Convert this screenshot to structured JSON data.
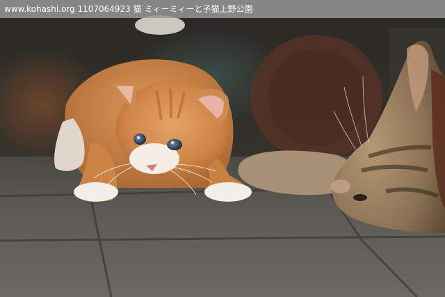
{
  "caption": {
    "text": "www.kohashi.org  1107064923 猫 ミィーミィーと子猫上野公園"
  },
  "colors": {
    "caption_bar": "#969696",
    "caption_text": "#ffffff",
    "pavement": "#57564f",
    "kitten_fur": "#d48a4c",
    "kitten_white": "#f1ece6",
    "tabby_fur": "#8a7355"
  }
}
